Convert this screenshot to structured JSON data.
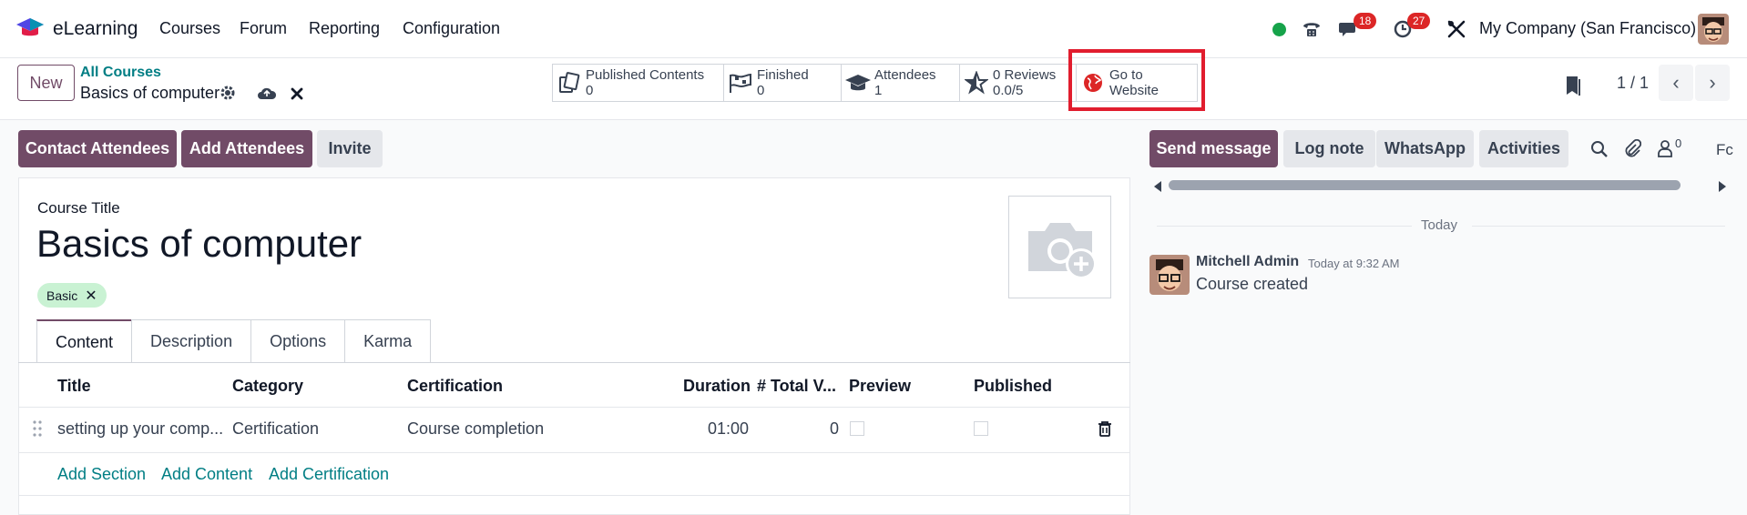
{
  "navbar": {
    "app_name": "eLearning",
    "menus": [
      "Courses",
      "Forum",
      "Reporting",
      "Configuration"
    ],
    "messages_count": "18",
    "activities_count": "27",
    "company": "My Company (San Francisco)"
  },
  "control": {
    "new_label": "New",
    "breadcrumb_parent": "All Courses",
    "breadcrumb_current": "Basics of computer",
    "pager": "1 / 1"
  },
  "smart_buttons": {
    "published": {
      "label": "Published Contents",
      "value": "0"
    },
    "finished": {
      "label": "Finished",
      "value": "0"
    },
    "attendees": {
      "label": "Attendees",
      "value": "1"
    },
    "reviews": {
      "label": "0 Reviews",
      "value": "0.0/5"
    },
    "website": {
      "line1": "Go to",
      "line2": "Website"
    }
  },
  "actions": {
    "contact": "Contact Attendees",
    "add": "Add Attendees",
    "invite": "Invite"
  },
  "form": {
    "field_label": "Course Title",
    "title": "Basics of computer",
    "tag": "Basic",
    "tabs": [
      "Content",
      "Description",
      "Options",
      "Karma"
    ],
    "columns": {
      "title": "Title",
      "category": "Category",
      "certification": "Certification",
      "duration": "Duration",
      "total_views": "# Total V...",
      "preview": "Preview",
      "published": "Published"
    },
    "row": {
      "title": "setting up your comp...",
      "category": "Certification",
      "certification": "Course completion",
      "duration": "01:00",
      "total_views": "0"
    },
    "links": {
      "section": "Add Section",
      "content": "Add Content",
      "certification": "Add Certification"
    }
  },
  "chatter": {
    "send": "Send message",
    "log": "Log note",
    "whatsapp": "WhatsApp",
    "activities": "Activities",
    "followers": "0",
    "follow_cut": "Fc",
    "date_sep": "Today",
    "author": "Mitchell Admin",
    "time": "Today at 9:32 AM",
    "body": "Course created"
  },
  "colors": {
    "primary": "#714b67",
    "link": "#017e84",
    "highlight": "#e11d2e",
    "online": "#16a34a",
    "badge": "#dc2626"
  }
}
